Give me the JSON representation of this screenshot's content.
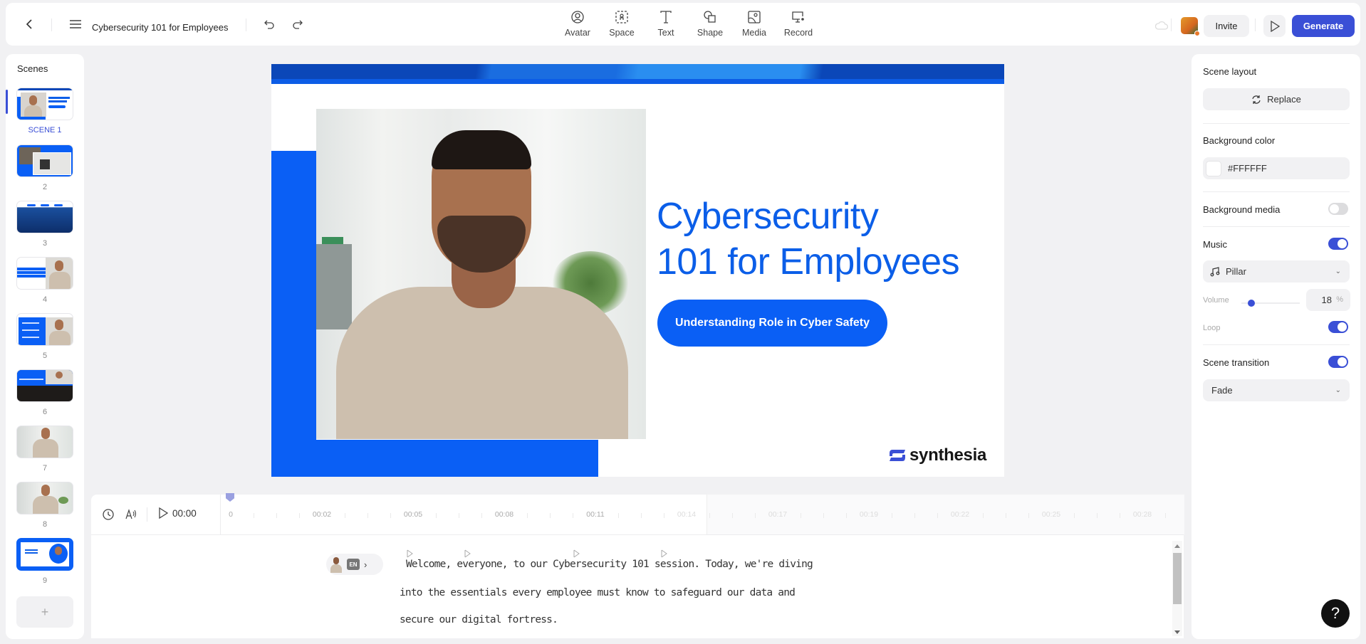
{
  "header": {
    "back_icon": "chevron-left-icon",
    "menu_icon": "hamburger-menu-icon",
    "title": "Cybersecurity 101 for Employees",
    "undo_icon": "undo-icon",
    "redo_icon": "redo-icon",
    "tools": [
      {
        "label": "Avatar",
        "icon": "avatar-icon"
      },
      {
        "label": "Space",
        "icon": "space-icon"
      },
      {
        "label": "Text",
        "icon": "text-icon"
      },
      {
        "label": "Shape",
        "icon": "shape-icon"
      },
      {
        "label": "Media",
        "icon": "media-icon"
      },
      {
        "label": "Record",
        "icon": "record-icon"
      }
    ],
    "invite_label": "Invite",
    "generate_label": "Generate",
    "accent_color": "#3a4fd6"
  },
  "scenes": {
    "title": "Scenes",
    "items": [
      {
        "label": "SCENE 1",
        "active": true
      },
      {
        "label": "2"
      },
      {
        "label": "3"
      },
      {
        "label": "4"
      },
      {
        "label": "5"
      },
      {
        "label": "6"
      },
      {
        "label": "7"
      },
      {
        "label": "8"
      },
      {
        "label": "9"
      }
    ],
    "add_label": "+"
  },
  "canvas": {
    "title_line1": "Cybersecurity",
    "title_line2": "101 for Employees",
    "pill_text": "Understanding Role in Cyber Safety",
    "logo_text": "synthesia",
    "brand_blue": "#0a5ff5"
  },
  "timeline": {
    "current_time": "00:00",
    "ticks": [
      "0",
      "00:02",
      "00:05",
      "00:08",
      "00:11",
      "00:14",
      "00:17",
      "00:19",
      "00:22",
      "00:25",
      "00:28"
    ],
    "filled_tick_count": 5
  },
  "script": {
    "language": "EN",
    "lines": [
      "Welcome, everyone, to our Cybersecurity 101 session. Today, we're diving",
      "into the essentials every employee must know to safeguard our data and",
      "secure our digital fortress."
    ]
  },
  "right_panel": {
    "scene_layout_label": "Scene layout",
    "replace_label": "Replace",
    "background_color_label": "Background color",
    "background_color_value": "#FFFFFF",
    "background_media_label": "Background media",
    "background_media_on": false,
    "music_label": "Music",
    "music_on": true,
    "music_track": "Pillar",
    "volume_label": "Volume",
    "volume_value": "18",
    "volume_unit": "%",
    "volume_fraction": 0.18,
    "loop_label": "Loop",
    "loop_on": true,
    "scene_transition_label": "Scene transition",
    "scene_transition_on": true,
    "transition_value": "Fade"
  },
  "help_label": "?"
}
